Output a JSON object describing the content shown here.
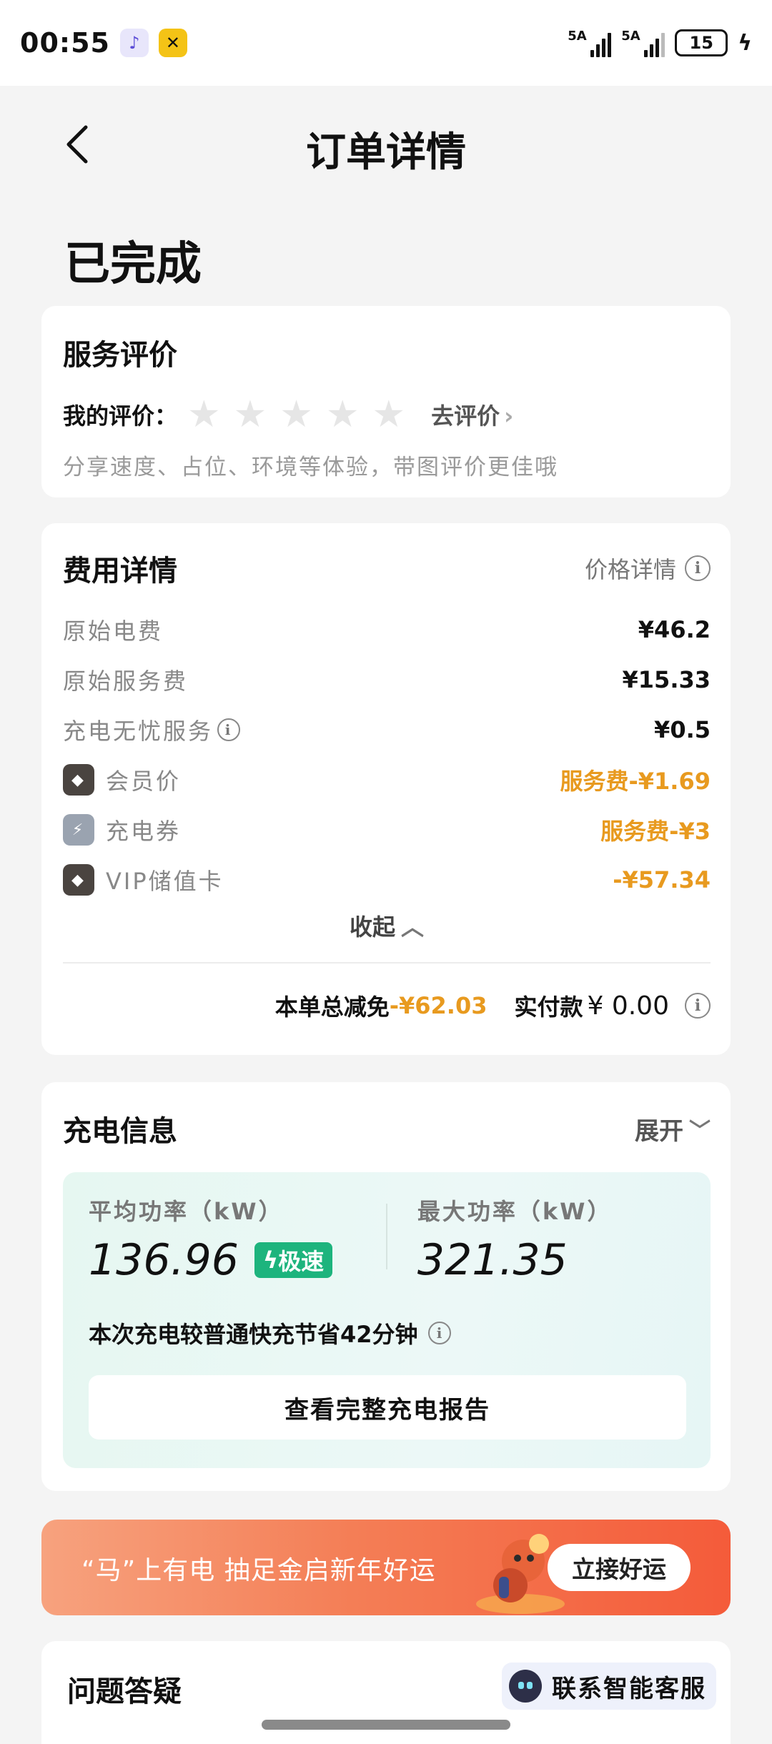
{
  "status_bar": {
    "time": "00:55",
    "app_icons": [
      "tiktok-icon",
      "x-app-icon"
    ],
    "signal1_label": "5A",
    "signal2_label": "5A",
    "battery": "15"
  },
  "header": {
    "title": "订单详情"
  },
  "order_status": "已完成",
  "review": {
    "title": "服务评价",
    "my_review_label": "我的评价：",
    "stars": 0,
    "star_count": 5,
    "go_review": "去评价",
    "hint": "分享速度、占位、环境等体验，带图评价更佳哦"
  },
  "fees": {
    "title": "费用详情",
    "price_detail": "价格详情",
    "rows": [
      {
        "label": "原始电费",
        "value": "¥46.2",
        "icon": "",
        "info": false,
        "highlight": false
      },
      {
        "label": "原始服务费",
        "value": "¥15.33",
        "icon": "",
        "info": false,
        "highlight": false
      },
      {
        "label": "充电无忧服务",
        "value": "¥0.5",
        "icon": "",
        "info": true,
        "highlight": false
      },
      {
        "label": "会员价",
        "value": "服务费-¥1.69",
        "icon": "member-badge-icon",
        "info": false,
        "highlight": true
      },
      {
        "label": "充电券",
        "value": "服务费-¥3",
        "icon": "coupon-icon",
        "info": false,
        "highlight": true
      },
      {
        "label": "VIP储值卡",
        "value": "-¥57.34",
        "icon": "vip-card-icon",
        "info": false,
        "highlight": true
      }
    ],
    "collapse": "收起",
    "total_label": "本单总减免",
    "total_discount": "-¥62.03",
    "paid_label": "实付款",
    "paid_value": "¥ 0.00"
  },
  "charge": {
    "title": "充电信息",
    "expand": "展开",
    "avg_power_label": "平均功率（kW）",
    "avg_power_value": "136.96",
    "speed_badge": "极速",
    "max_power_label": "最大功率（kW）",
    "max_power_value": "321.35",
    "save_text": "本次充电较普通快充节省42分钟",
    "report_button": "查看完整充电报告"
  },
  "banner": {
    "text": "“马”上有电 抽足金启新年好运",
    "button": "立接好运"
  },
  "qa": {
    "title": "问题答疑",
    "support_button": "联系智能客服"
  },
  "colors": {
    "accent_orange": "#e89a1f",
    "speed_green": "#1db47d",
    "banner_orange": "#f47e56"
  }
}
